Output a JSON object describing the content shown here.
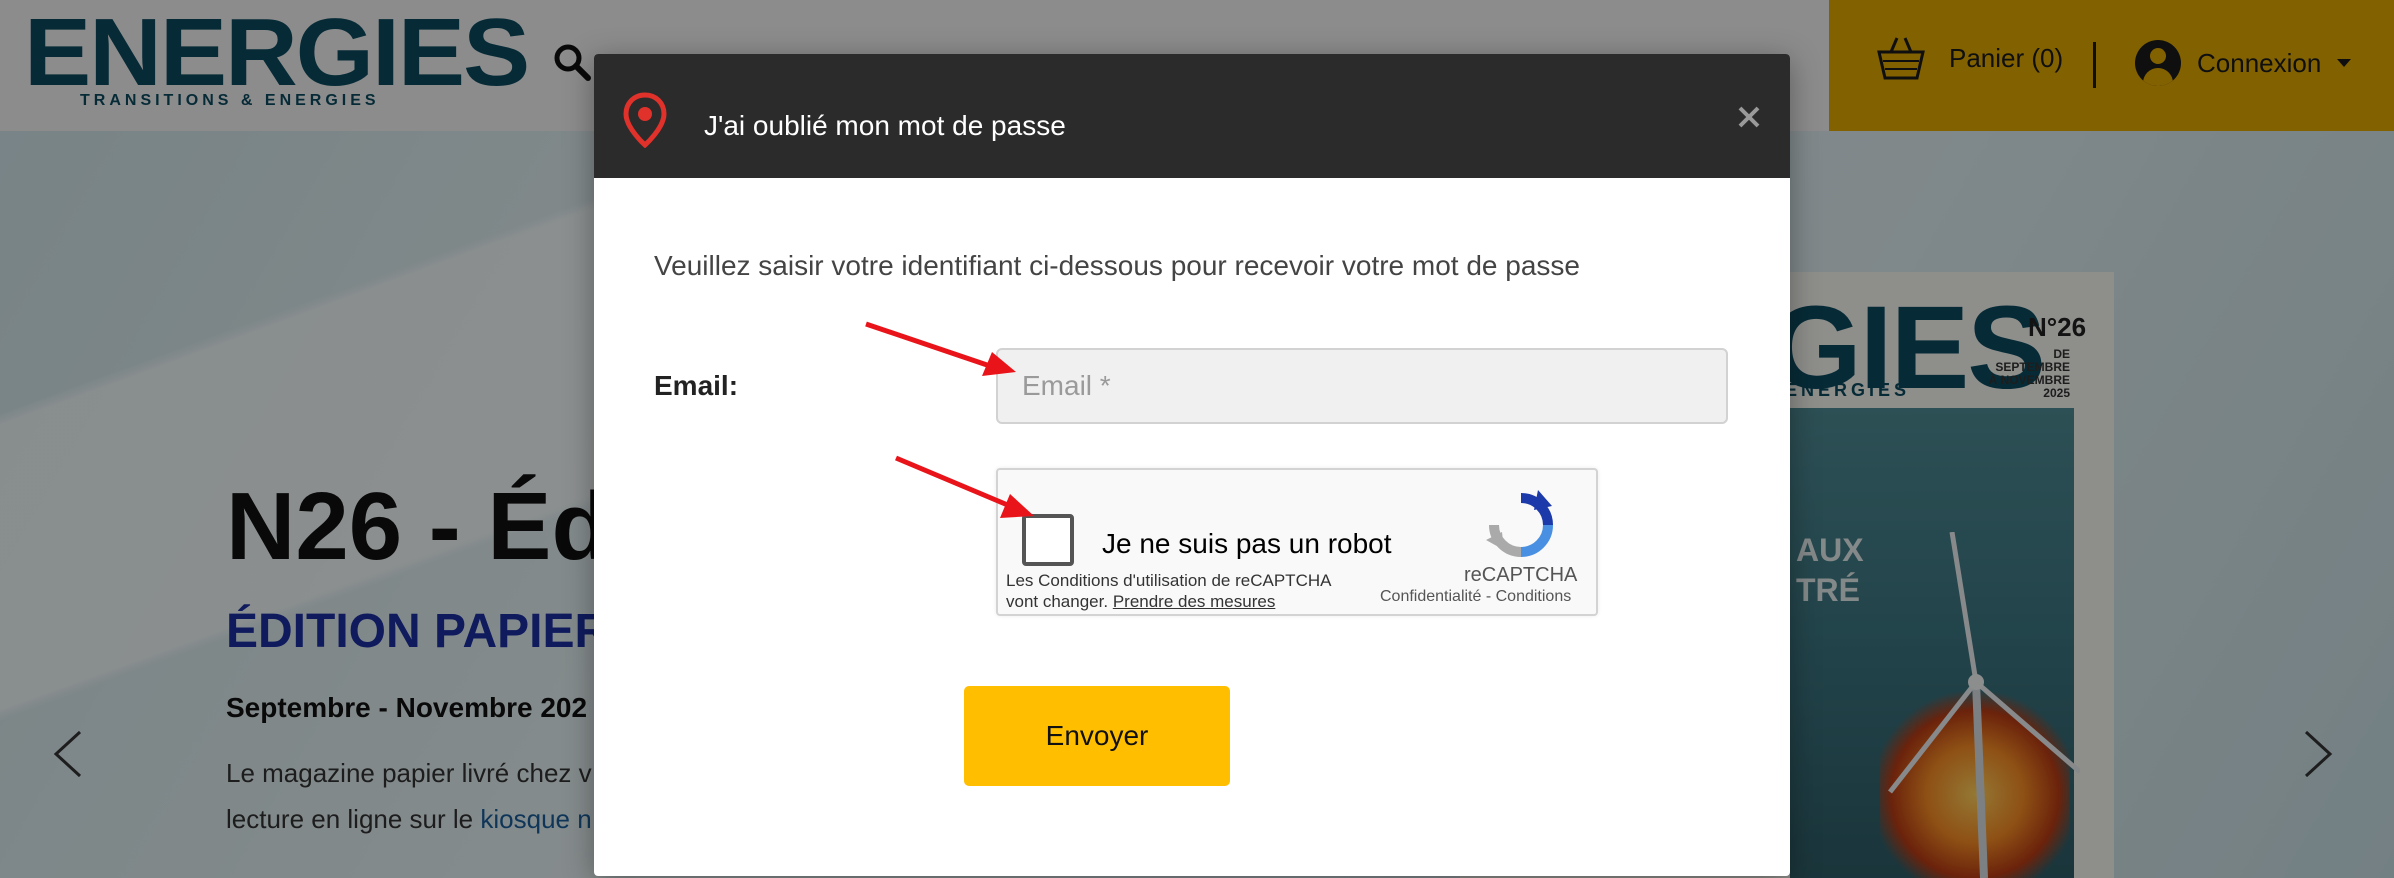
{
  "background_page": {
    "logo": {
      "main": "ENERGIES",
      "sub": "TRANSITIONS & ENERGIES"
    },
    "header": {
      "search_icon": "search-icon",
      "cart_label": "Panier (0)",
      "cart_icon": "basket-icon",
      "login_label": "Connexion",
      "login_icon": "user-avatar-icon"
    },
    "hero": {
      "title": "N26 - Éd",
      "subtitle": "ÉDITION PAPIER",
      "date": "Septembre - Novembre 202",
      "text_line1": "Le magazine papier livré chez v",
      "text_line2_prefix": "lecture en ligne sur le ",
      "text_line2_link": "kiosque n"
    },
    "cover": {
      "title": "GIES",
      "subtitle": "ENERGIES",
      "issue": "N°26",
      "date": "DE SEPTEMBRE À NOVEMBRE 2025",
      "text_line1": "AUX",
      "text_line2": "TRÉ"
    }
  },
  "modal": {
    "title": "J'ai oublié mon mot de passe",
    "pin_icon": "map-pin-icon",
    "close_icon": "close-icon",
    "close_glyph": "×",
    "instruction": "Veuillez saisir votre identifiant ci-dessous pour recevoir votre mot de passe",
    "email_label": "Email:",
    "email_placeholder": "Email *",
    "email_value": "",
    "recaptcha": {
      "checkbox_label": "Je ne suis pas un robot",
      "checked": false,
      "terms_line1": "Les Conditions d'utilisation de reCAPTCHA",
      "terms_line2_prefix": "vont changer. ",
      "terms_link": "Prendre des mesures",
      "brand": "reCAPTCHA",
      "privacy": "Confidentialité",
      "separator": " - ",
      "conditions": "Conditions"
    },
    "submit_label": "Envoyer"
  },
  "colors": {
    "accent_yellow": "#ffbf00",
    "header_yellow": "#e0a800",
    "brand_blue": "#0c4a60",
    "annotation_red": "#e8141a"
  }
}
